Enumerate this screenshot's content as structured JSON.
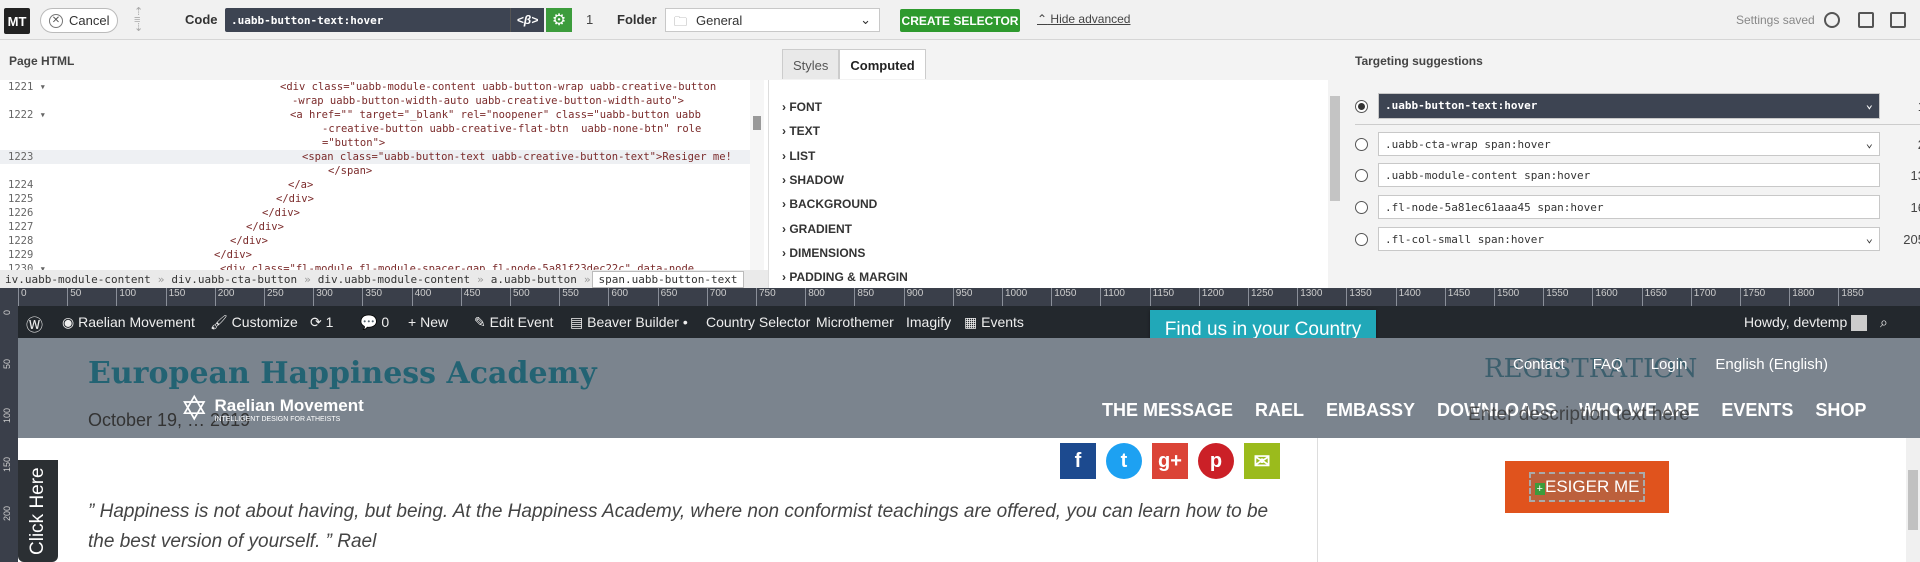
{
  "toolbar": {
    "logo": "MT",
    "cancel_label": "Cancel",
    "code_label": "Code",
    "code_value": ".uabb-button-text:hover",
    "code_btn": "<β>",
    "code_count": "1",
    "folder_label": "Folder",
    "folder_value": "General",
    "create_label": "CREATE SELECTOR",
    "hide_advanced": "Hide advanced",
    "settings_saved": "Settings saved"
  },
  "panels": {
    "page_html": "Page HTML",
    "tabs": [
      "Styles",
      "Computed"
    ],
    "targeting": "Targeting suggestions"
  },
  "code_lines": [
    {
      "num": "1221",
      "fold": "▾",
      "text": "<div class=\"uabb-module-content uabb-button-wrap uabb-creative-button"
    },
    {
      "num": "",
      "fold": "",
      "text": "-wrap uabb-button-width-auto uabb-creative-button-width-auto\">"
    },
    {
      "num": "1222",
      "fold": "▾",
      "text": "<a href=\"\" target=\"_blank\" rel=\"noopener\" class=\"uabb-button uabb"
    },
    {
      "num": "",
      "fold": "",
      "text": "-creative-button uabb-creative-flat-btn  uabb-none-btn\" role"
    },
    {
      "num": "",
      "fold": "",
      "text": "=\"button\">"
    },
    {
      "num": "1223",
      "fold": "",
      "text": "<span class=\"uabb-button-text uabb-creative-button-text\">Resiger me!"
    },
    {
      "num": "",
      "fold": "",
      "text": "</span>"
    },
    {
      "num": "1224",
      "fold": "",
      "text": "</a>"
    },
    {
      "num": "1225",
      "fold": "",
      "text": "</div>"
    },
    {
      "num": "1226",
      "fold": "",
      "text": "</div>"
    },
    {
      "num": "1227",
      "fold": "",
      "text": "</div>"
    },
    {
      "num": "1228",
      "fold": "",
      "text": "</div>"
    },
    {
      "num": "1229",
      "fold": "",
      "text": "</div>"
    },
    {
      "num": "1230",
      "fold": "▾",
      "text": "<div class=\"fl-module fl-module-spacer-gap fl-node-5a81f23dec22c\" data-node"
    }
  ],
  "breadcrumb": [
    "iv.uabb-module-content",
    "div.uabb-cta-button",
    "div.uabb-module-content",
    "a.uabb-button",
    "span.uabb-button-text"
  ],
  "computed_props": [
    "FONT",
    "TEXT",
    "LIST",
    "SHADOW",
    "BACKGROUND",
    "GRADIENT",
    "DIMENSIONS",
    "PADDING & MARGIN"
  ],
  "suggestions": [
    {
      "selector": ".uabb-button-text:hover",
      "count": "1",
      "selected": true,
      "dropdown": true
    },
    {
      "selector": ".uabb-cta-wrap span:hover",
      "count": "2",
      "selected": false,
      "dropdown": true
    },
    {
      "selector": ".uabb-module-content span:hover",
      "count": "13",
      "selected": false,
      "dropdown": false
    },
    {
      "selector": ".fl-node-5a81ec61aaa45 span:hover",
      "count": "16",
      "selected": false,
      "dropdown": false
    },
    {
      "selector": ".fl-col-small span:hover",
      "count": "205",
      "selected": false,
      "dropdown": true
    }
  ],
  "ruler_ticks": [
    "0",
    "50",
    "100",
    "150",
    "200",
    "250",
    "300",
    "350",
    "400",
    "450",
    "500",
    "550",
    "600",
    "650",
    "700",
    "750",
    "800",
    "850",
    "900",
    "950",
    "1000",
    "1050",
    "1100",
    "1150",
    "1200",
    "1250",
    "1300",
    "1350",
    "1400",
    "1450",
    "1500",
    "1550",
    "1600",
    "1650",
    "1700",
    "1750",
    "1800",
    "1850"
  ],
  "vruler_ticks": [
    "0",
    "50",
    "100",
    "150",
    "200"
  ],
  "adminbar": {
    "site": "Raelian Movement",
    "customize": "Customize",
    "updates": "1",
    "comments": "0",
    "new": "New",
    "edit_event": "Edit Event",
    "beaver": "Beaver Builder •",
    "country": "Country Selector",
    "microthemer": "Microthemer",
    "imagify": "Imagify",
    "events": "Events",
    "howdy": "Howdy, devtemp"
  },
  "site": {
    "find_us": "Find us in your Country",
    "title": "European Happiness Academy",
    "date": "October 19, … 2019",
    "brand_name": "Raelian Movement",
    "brand_tagline": "INTELLIGENT DESIGN FOR ATHEISTS",
    "top_nav": [
      "Contact",
      "FAQ",
      "Login",
      "English (English)"
    ],
    "registration": "REGISTRATION",
    "nav": [
      "THE MESSAGE",
      "RAEL",
      "EMBASSY",
      "DOWNLOADS",
      "WHO WE ARE",
      "EVENTS",
      "SHOP"
    ],
    "description": "Enter description text here",
    "quote": "” Happiness is not about having, but being. At the Happiness Academy, where non conformist teachings are offered, you can learn how to be the best version of yourself. ” Rael",
    "reg_button": "ESIGER ME",
    "click_here": "Click Here"
  },
  "colors": {
    "accent": "#2e9a2e",
    "dark": "#3d4452",
    "teal": "#21a8b8",
    "orange": "#e0531d"
  }
}
